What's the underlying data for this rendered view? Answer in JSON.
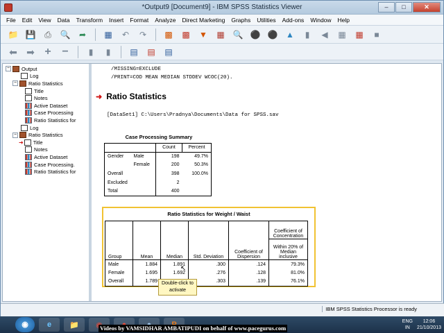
{
  "window": {
    "title": "*Output9 [Document9] - IBM SPSS Statistics Viewer"
  },
  "menu": [
    "File",
    "Edit",
    "View",
    "Data",
    "Transform",
    "Insert",
    "Format",
    "Analyze",
    "Direct Marketing",
    "Graphs",
    "Utilities",
    "Add-ons",
    "Window",
    "Help"
  ],
  "nav": {
    "items": [
      "Output",
      "Log",
      "Ratio Statistics",
      "Title",
      "Notes",
      "Active Dataset",
      "Case Processing",
      "Ratio Statistics for",
      "Log",
      "Ratio Statistics",
      "Title",
      "Notes",
      "Active Dataset",
      "Case Processing.",
      "Ratio Statistics for"
    ]
  },
  "syntax": {
    "line1": "/MISSING=EXCLUDE",
    "line2": "/PRINT=COD MEAN MEDIAN STDDEV WCOC(20)."
  },
  "heading": "Ratio Statistics",
  "dataset": "[DataSet1] C:\\Users\\Pradnya\\Documents\\Data for SPSS.sav",
  "case_processing": {
    "title": "Case Processing Summary",
    "headers": [
      "Count",
      "Percent"
    ],
    "rows": [
      {
        "label1": "Gender",
        "label2": "Male",
        "count": "198",
        "percent": "49.7%"
      },
      {
        "label1": "",
        "label2": "Female",
        "count": "200",
        "percent": "50.3%"
      },
      {
        "label1": "Overall",
        "label2": "",
        "count": "398",
        "percent": "100.0%"
      },
      {
        "label1": "Excluded",
        "label2": "",
        "count": "2",
        "percent": ""
      },
      {
        "label1": "Total",
        "label2": "",
        "count": "400",
        "percent": ""
      }
    ]
  },
  "ratio_stats": {
    "title": "Ratio Statistics for Weight / Waist",
    "coc_header": "Coefficient of Concentration",
    "headers": {
      "group": "Group",
      "mean": "Mean",
      "median": "Median",
      "std": "Std. Deviation",
      "cod": "Coefficient of Dispersion",
      "within": "Within 20% of Median inclusive"
    },
    "rows": [
      {
        "group": "Male",
        "mean": "1.884",
        "median": "1.891",
        "std": ".300",
        "cod": ".124",
        "within": "79.3%"
      },
      {
        "group": "Female",
        "mean": "1.695",
        "median": "1.692",
        "std": ".276",
        "cod": ".128",
        "within": "81.0%"
      },
      {
        "group": "Overall",
        "mean": "1.789",
        "median": "",
        "std": ".303",
        "cod": ".139",
        "within": "76.1%"
      }
    ]
  },
  "tooltip": {
    "line1": "Double-click to",
    "line2": "activate"
  },
  "status": "IBM SPSS Statistics Processor is ready",
  "taskbar": {
    "watermark": "Videos by VAMSIDHAR AMBATIPUDI on behalf of www.pacegurus.com",
    "lang1": "ENG",
    "lang2": "IN",
    "time": "12:06",
    "date": "21/10/2013"
  }
}
